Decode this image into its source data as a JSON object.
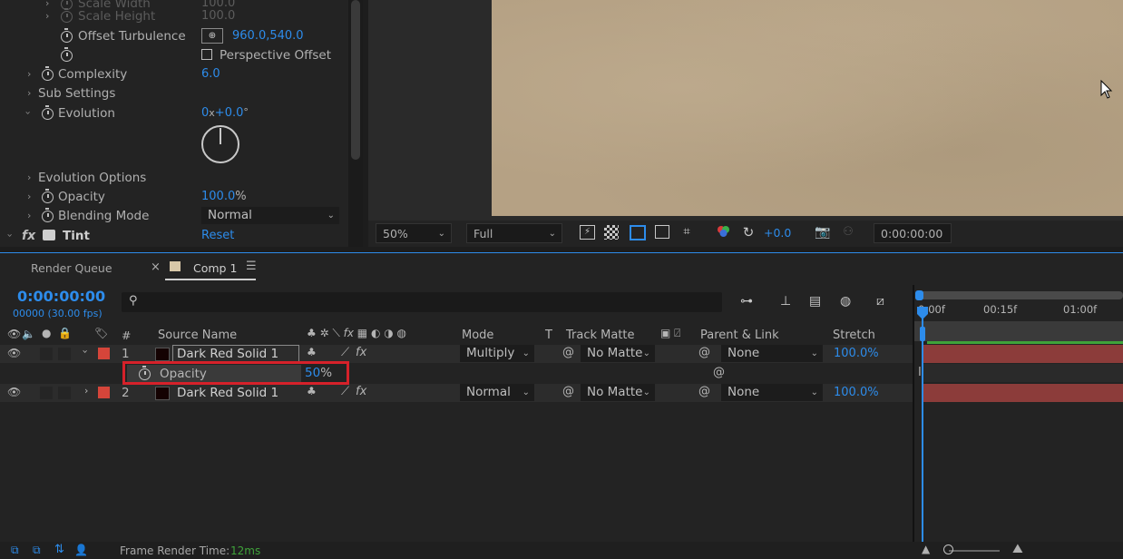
{
  "effect_controls": {
    "rows": [
      {
        "label": "Scale Width",
        "value": "100.0"
      },
      {
        "label": "Scale Height",
        "value": "100.0"
      },
      {
        "label": "Offset Turbulence",
        "value": "960.0,540.0"
      },
      {
        "label": "Perspective Offset"
      },
      {
        "label": "Complexity",
        "value": "6.0"
      },
      {
        "label": "Sub Settings"
      },
      {
        "label": "Evolution",
        "value_rev": "0",
        "value_x": "x",
        "value_deg": "+0.0",
        "value_degsym": "°"
      },
      {
        "label": "Evolution Options"
      },
      {
        "label": "Opacity",
        "value": "100.0",
        "unit": "%"
      },
      {
        "label": "Blending Mode",
        "value": "Normal"
      },
      {
        "label": "Tint",
        "fx": "fx",
        "value": "Reset"
      }
    ]
  },
  "viewer": {
    "zoom": "50%",
    "resolution": "Full",
    "exposure": "+0.0",
    "timecode": "0:00:00:00"
  },
  "tabs": [
    {
      "label": "Render Queue"
    },
    {
      "label": "Comp 1",
      "active": true
    }
  ],
  "tab_close": "×",
  "tab_menu": "☰",
  "timeline": {
    "timecode": "0:00:00:00",
    "frames": "00000 (30.00 fps)",
    "search_placeholder": "",
    "columns": {
      "hash": "#",
      "source_name": "Source Name",
      "mode": "Mode",
      "t": "T",
      "track_matte": "Track Matte",
      "parent_link": "Parent & Link",
      "stretch": "Stretch"
    },
    "ruler": [
      "0:00f",
      "00:15f",
      "01:00f"
    ],
    "layers": [
      {
        "num": "1",
        "name": "Dark Red Solid 1",
        "mode": "Multiply",
        "matte": "No Matte",
        "parent": "None",
        "stretch": "100.0%"
      },
      {
        "num": "2",
        "name": "Dark Red Solid 1",
        "mode": "Normal",
        "matte": "No Matte",
        "parent": "None",
        "stretch": "100.0%"
      }
    ],
    "opacity_prop": {
      "label": "Opacity",
      "value": "50",
      "unit": "%"
    }
  },
  "status": {
    "label": "Frame Render Time:",
    "value": "12ms"
  },
  "colors": {
    "accent": "#2d8ceb",
    "layer_label": "#d5453a",
    "highlight": "#d6212a",
    "layer_bar": "#8c3c3a"
  }
}
